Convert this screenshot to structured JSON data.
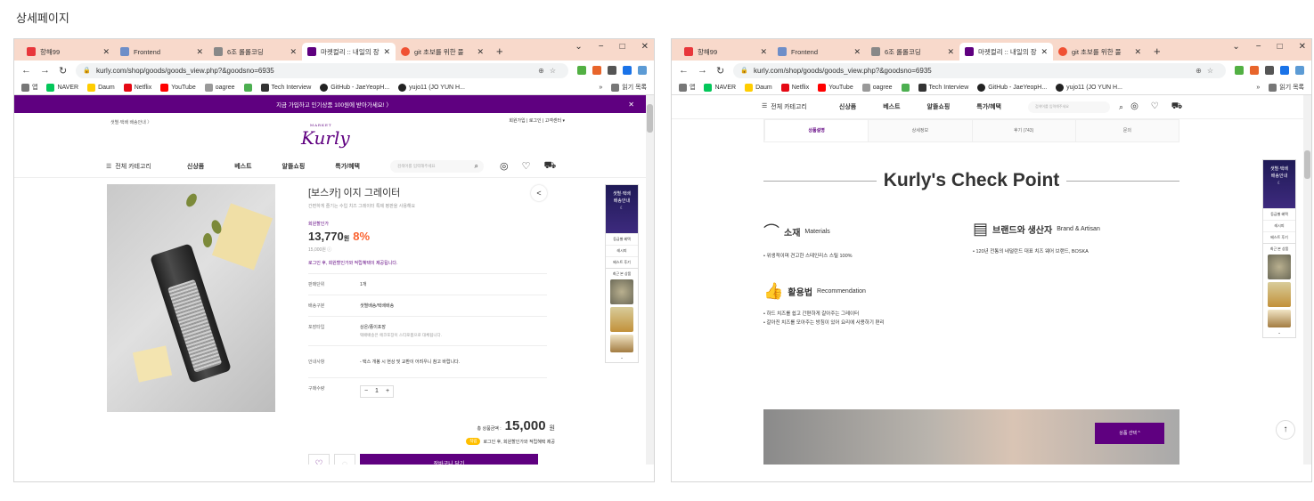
{
  "page_caption": "상세페이지",
  "browser": {
    "tabs": [
      {
        "title": "항해99",
        "color": "#e8373b",
        "active": false
      },
      {
        "title": "Frontend",
        "color": "#6e8ec8",
        "active": false
      },
      {
        "title": "6조 롤롤코딩",
        "color": "#888888",
        "active": false
      },
      {
        "title": "마켓컬리 :: 내일의 장",
        "color": "#5f0080",
        "active": true
      },
      {
        "title": "git 초보를 위한 풀",
        "color": "#f05133",
        "active": false
      }
    ],
    "tab_add": "+",
    "window_controls": [
      "⌄",
      "−",
      "□",
      "✕"
    ],
    "url": "kurly.com/shop/goods/goods_view.php?&goodsno=6935",
    "bookmarks": [
      {
        "label": "앱",
        "color": "#777777"
      },
      {
        "label": "NAVER",
        "color": "#03c75a"
      },
      {
        "label": "Daum",
        "color": "#ffcd00"
      },
      {
        "label": "Netflix",
        "color": "#e50914"
      },
      {
        "label": "YouTube",
        "color": "#ff0000"
      },
      {
        "label": "oagree",
        "color": "#999999"
      },
      {
        "label": "",
        "color": "#4caf50"
      },
      {
        "label": "Tech Interview",
        "color": "#333333"
      },
      {
        "label": "GitHub - JaeYeopH...",
        "color": "#222222"
      },
      {
        "label": "yujo11 (JO YUN H...",
        "color": "#222222"
      }
    ],
    "bookmarks_more": "»",
    "reading_list": "읽기 목록"
  },
  "left": {
    "promo_text": "지금 가입하고 인기상품 100원에 받아가세요!",
    "promo_arrow": "〉",
    "promo_close": "✕",
    "delivery_link": "샛별·택배 배송안내 〉",
    "user_menu": "회원가입  |  로그인  |  고객센터 ▾",
    "logo_small": "MARKET",
    "logo": "Kurly",
    "gnb": {
      "category": "전체 카테고리",
      "menus": [
        "신상품",
        "베스트",
        "알뜰쇼핑",
        "특가/혜택"
      ],
      "search_placeholder": "검색어를 입력해주세요",
      "search_icon": "⌕",
      "icons": [
        "◎",
        "♡",
        "⛟"
      ]
    },
    "product": {
      "name": "[보스카] 이지 그레이터",
      "desc": "간편하게 즐기는 수입 치즈 그레이터 특제 평판을 사용해요",
      "share_icon": "<",
      "price_label": "회원할인가",
      "price": "13,770",
      "won": "원",
      "rate": "8%",
      "original": "15,000원 ⓘ",
      "login_note": "로그인 후, 회원할인가와 적립혜택이 제공됩니다.",
      "rows": [
        {
          "k": "판매단위",
          "v": "1개",
          "sub": ""
        },
        {
          "k": "배송구분",
          "v": "샛별배송/택배배송",
          "sub": ""
        },
        {
          "k": "포장타입",
          "v": "상온/종이포장",
          "sub": "택배배송은 에코포장이 스티로폼으로 대체됩니다."
        },
        {
          "k": "안내사항",
          "v": "- 택스 개봉 시 현상 및 교환이 어려우니 참고 바랍니다.",
          "sub": ""
        },
        {
          "k": "구매수량",
          "v": "",
          "sub": ""
        }
      ],
      "qty_minus": "−",
      "qty": "1",
      "qty_plus": "+",
      "total_label": "총 상품금액 :",
      "total": "15,000",
      "total_won": "원",
      "coupon_badge": "적립",
      "coupon_note": "로그인 후, 회원할인가와 적립혜택 제공",
      "wish_icon": "♡",
      "alarm_icon": "🔔",
      "cart_button": "장바구니 담기"
    },
    "side": {
      "banner": [
        "샛별·택배",
        "배송안내"
      ],
      "links": [
        "등급별 혜택",
        "레시피",
        "베스트 후기"
      ],
      "recent": "최근 본 상품",
      "down": "⌄"
    }
  },
  "right": {
    "gnb": {
      "category": "전체 카테고리",
      "menus": [
        "신상품",
        "베스트",
        "알뜰쇼핑",
        "특가/혜택"
      ],
      "search_placeholder": "검색어를 입력해주세요",
      "search_icon": "⌕",
      "icons": [
        "◎",
        "♡",
        "⛟"
      ]
    },
    "tabs": [
      "상품설명",
      "상세정보",
      "후기 (743)",
      "문의"
    ],
    "checkpoint_title": "Kurly's Check Point",
    "materials": {
      "title": "소재",
      "sub": "Materials",
      "body": "• 위생적이며 견고한 스테인리스 스틸 100%"
    },
    "brand": {
      "title": "브랜드와 생산자",
      "sub": "Brand & Artisan",
      "body": "• 120년 전통의 네덜란드 대표 치즈 웨어 브랜드, BOSKA"
    },
    "usage": {
      "title": "활용법",
      "sub": "Recommendation",
      "body1": "• 하드 치즈를 쉽고 간편하게 갈아주는 그레이터",
      "body2": "• 갈아진 치즈를 모아주는 방침이 있어 요리에 사용하기 편리"
    },
    "select_button": "상품 선택 ^",
    "top_button": "↑",
    "side": {
      "banner": [
        "샛별·택배",
        "배송안내"
      ],
      "links": [
        "등급별 혜택",
        "레시피",
        "베스트 후기"
      ],
      "recent": "최근 본 상품",
      "down": "⌄"
    }
  }
}
